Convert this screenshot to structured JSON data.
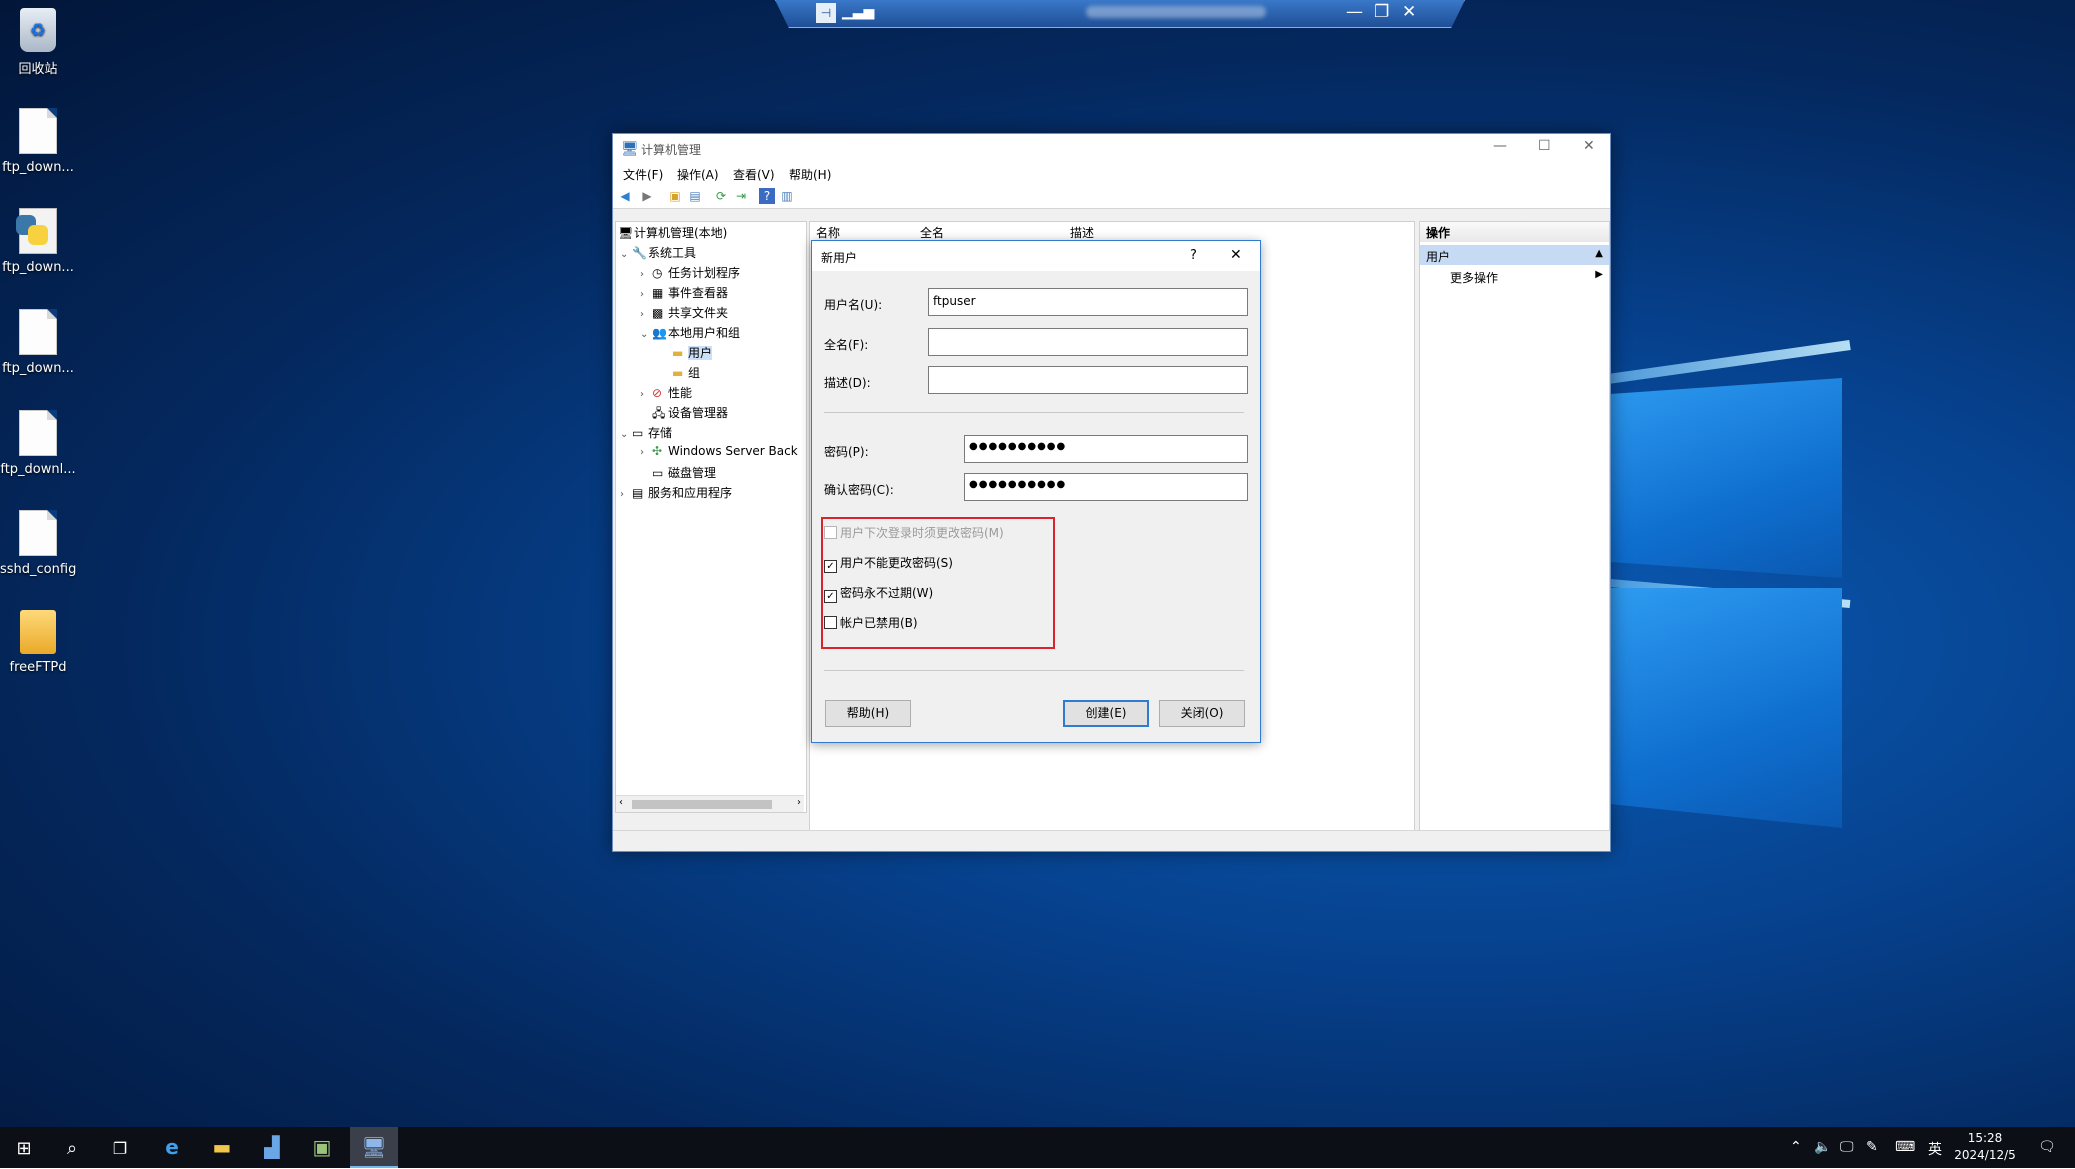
{
  "desktop": {
    "icons": [
      {
        "label": "回收站",
        "icon": "recycle-bin-icon"
      },
      {
        "label": "ftp_down...",
        "icon": "file-icon"
      },
      {
        "label": "ftp_down...",
        "icon": "python-file-icon"
      },
      {
        "label": "ftp_down...",
        "icon": "file-icon"
      },
      {
        "label": "ftp_downl...",
        "icon": "file-icon"
      },
      {
        "label": "sshd_config",
        "icon": "file-icon"
      },
      {
        "label": "freeFTPd",
        "icon": "folder-shortcut-icon"
      }
    ]
  },
  "remote_bar": {
    "pin_icon": "pin-icon",
    "signal_icon": "signal-icon",
    "minimize": "—",
    "restore": "❐",
    "close": "✕"
  },
  "window": {
    "title": "计算机管理",
    "menu": [
      "文件(F)",
      "操作(A)",
      "查看(V)",
      "帮助(H)"
    ],
    "tree": {
      "root": "计算机管理(本地)",
      "system_tools": "系统工具",
      "task_scheduler": "任务计划程序",
      "event_viewer": "事件查看器",
      "shared_folders": "共享文件夹",
      "local_users_groups": "本地用户和组",
      "users": "用户",
      "groups": "组",
      "performance": "性能",
      "device_manager": "设备管理器",
      "storage": "存储",
      "windows_server_backup": "Windows Server Back",
      "disk_management": "磁盘管理",
      "services_apps": "服务和应用程序"
    },
    "columns": [
      "名称",
      "全名",
      "描述"
    ],
    "actions": {
      "header": "操作",
      "section": "用户",
      "more": "更多操作"
    }
  },
  "dialog": {
    "title": "新用户",
    "help_glyph": "?",
    "close_glyph": "✕",
    "username_label": "用户名(U):",
    "username_value": "ftpuser",
    "fullname_label": "全名(F):",
    "fullname_value": "",
    "description_label": "描述(D):",
    "description_value": "",
    "password_label": "密码(P):",
    "password_value": "●●●●●●●●●●",
    "confirm_label": "确认密码(C):",
    "confirm_value": "●●●●●●●●●●",
    "options": [
      {
        "label": "用户下次登录时须更改密码(M)",
        "checked": false,
        "disabled": true
      },
      {
        "label": "用户不能更改密码(S)",
        "checked": true,
        "disabled": false
      },
      {
        "label": "密码永不过期(W)",
        "checked": true,
        "disabled": false
      },
      {
        "label": "帐户已禁用(B)",
        "checked": false,
        "disabled": false
      }
    ],
    "help_button": "帮助(H)",
    "create_button": "创建(E)",
    "close_button": "关闭(O)"
  },
  "taskbar": {
    "tray": {
      "ime": "英",
      "time": "15:28",
      "date": "2024/12/5"
    }
  },
  "colors": {
    "accent": "#2f7bd3",
    "highlight_box": "#d9242b",
    "selection": "#cce0f7"
  }
}
